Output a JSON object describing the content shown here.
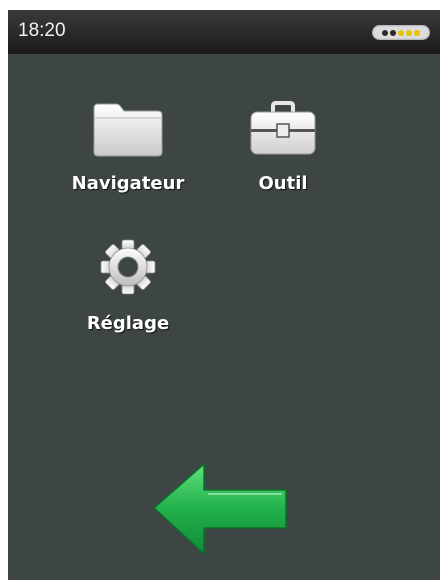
{
  "status": {
    "time": "18:20",
    "battery_level": 0.4,
    "battery_color": "#e8c400"
  },
  "apps": [
    {
      "label": "Navigateur",
      "icon": "folder-icon"
    },
    {
      "label": "Outil",
      "icon": "toolbox-icon"
    },
    {
      "label": "Réglage",
      "icon": "gear-icon"
    }
  ],
  "back": {
    "icon": "back-arrow-icon",
    "color": "#22b14c"
  },
  "colors": {
    "background": "#3e4645",
    "statusbar": "#1b1b1b",
    "text": "#ffffff"
  }
}
